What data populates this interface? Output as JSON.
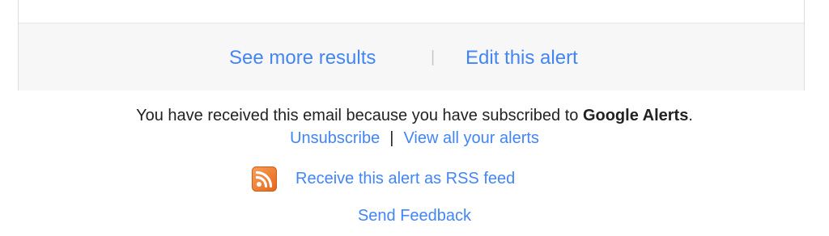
{
  "card": {
    "see_more_label": "See more results",
    "separator": "|",
    "edit_alert_label": "Edit this alert"
  },
  "notice": {
    "text_before": "You have received this email because you have subscribed to ",
    "brand": "Google Alerts",
    "text_after": "."
  },
  "links": {
    "unsubscribe": "Unsubscribe",
    "separator": "|",
    "view_all": "View all your alerts"
  },
  "rss": {
    "icon": "rss-feed-icon",
    "label": "Receive this alert as RSS feed"
  },
  "feedback": {
    "label": "Send Feedback"
  },
  "colors": {
    "link": "#4285f4",
    "text": "#222222",
    "footer_bg": "#f7f7f7",
    "rss_orange": "#f07d2b"
  }
}
